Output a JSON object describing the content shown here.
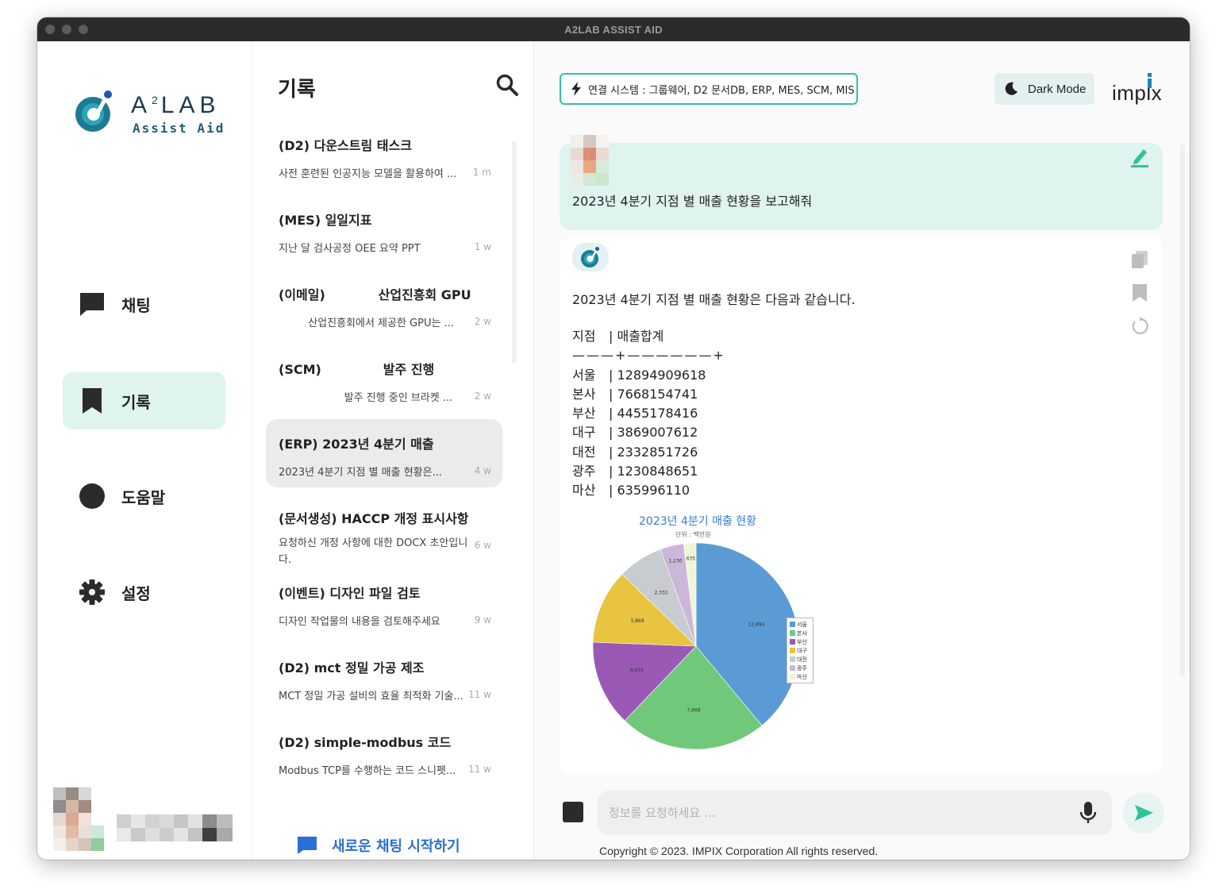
{
  "window": {
    "title": "A2LAB ASSIST AID"
  },
  "logo": {
    "name": "LAB",
    "sup": "2",
    "letter": "A",
    "sub": "Assist Aid"
  },
  "nav": {
    "items": [
      {
        "label": "채팅"
      },
      {
        "label": "기록"
      },
      {
        "label": "도움말"
      },
      {
        "label": "설정"
      }
    ]
  },
  "history": {
    "title": "기록",
    "items": [
      {
        "title": "(D2) 다운스트림 태스크",
        "preview": "사전 훈련된 인공지능 모델을 활용하여 ...",
        "age": "1 m"
      },
      {
        "title": "(MES) 일일지표",
        "preview": "지난 달 검사공정 OEE 요약 PPT",
        "age": "1 w"
      },
      {
        "title": "(이메일)            산업진흥회 GPU",
        "preview": "         산업진흥회에서 제공한 GPU는 ...",
        "age": "2 w"
      },
      {
        "title": "(SCM)              발주 진행",
        "preview": "                    발주 진행 중인 브라켓 ...",
        "age": "2 w"
      },
      {
        "title": "(ERP) 2023년 4분기 매출",
        "preview": "2023년 4분기 지점 별 매출 현황은...",
        "age": "4 w"
      },
      {
        "title": "(문서생성) HACCP 개정 표시사항",
        "preview": "요청하신 개정 사항에 대한 DOCX 초안입니다.",
        "age": "6 w"
      },
      {
        "title": "(이벤트) 디자인 파일 검토",
        "preview": "디자인 작업물의 내용을 검토해주세요",
        "age": "9 w"
      },
      {
        "title": "(D2) mct 정밀 가공 제조",
        "preview": "MCT 정밀 가공 설비의 효율 최적화 기술...",
        "age": "11 w"
      },
      {
        "title": "(D2) simple-modbus 코드",
        "preview": "Modbus TCP를 수행하는 코드 스니펫...",
        "age": "11 w"
      }
    ],
    "new_chat_label": "새로운 채팅 시작하기"
  },
  "chat": {
    "connected_systems": "연결 시스템 : 그룹웨어, D2 문서DB, ERP, MES, SCM, MIS",
    "dark_mode_label": "Dark Mode",
    "brand": "implx",
    "user_message": "2023년 4분기 지점 별 매출 현황을 보고해줘",
    "bot_intro": "2023년 4분기 지점 별 매출 현황은 다음과 같습니다.",
    "table": {
      "header": [
        "지점",
        "| 매출합계"
      ],
      "separator": "———+——————+",
      "rows": [
        [
          "서울",
          "| 12894909618"
        ],
        [
          "본사",
          "| 7668154741"
        ],
        [
          "부산",
          "| 4455178416"
        ],
        [
          "대구",
          "| 3869007612"
        ],
        [
          "대전",
          "| 2332851726"
        ],
        [
          "광주",
          "| 1230848651"
        ],
        [
          "마산",
          "| 635996110"
        ]
      ]
    },
    "input_placeholder": "정보를 요청하세요 ...",
    "input_value": "",
    "copyright": "Copyright © 2023. IMPIX Corporation All rights reserved."
  },
  "chart_data": {
    "type": "pie",
    "title": "2023년 4분기 매출 현황",
    "subtitle": "단위 : 백만원",
    "categories": [
      "서울",
      "본사",
      "부산",
      "대구",
      "대전",
      "광주",
      "마산"
    ],
    "values": [
      12894,
      7668,
      4455,
      3869,
      2332,
      1230,
      635
    ],
    "data_labels": [
      "12,894",
      "7,668",
      "4,455",
      "3,869",
      "2,332",
      "1,230",
      "635"
    ],
    "colors": [
      "#5b9bd5",
      "#70c97a",
      "#9b59b6",
      "#e8c440",
      "#c8cbcf",
      "#cdb7d9",
      "#eef6d6"
    ],
    "legend": "right"
  },
  "colors": {
    "accent": "#2fc39b",
    "active_nav_bg": "#dff3ef",
    "link_blue": "#2a6fd6"
  }
}
